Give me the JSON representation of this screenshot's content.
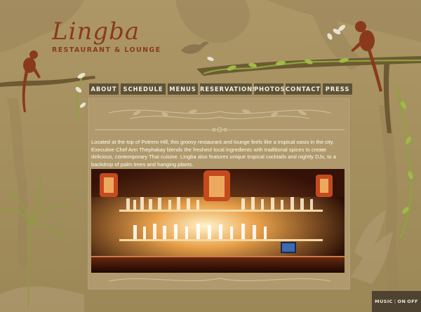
{
  "brand": {
    "name": "Lingba",
    "tagline": "RESTAURANT & LOUNGE"
  },
  "nav": {
    "items": [
      {
        "label": "ABOUT"
      },
      {
        "label": "SCHEDULE"
      },
      {
        "label": "MENUS"
      },
      {
        "label": "RESERVATIONS"
      },
      {
        "label": "PHOTOS"
      },
      {
        "label": "CONTACT"
      },
      {
        "label": "PRESS"
      }
    ]
  },
  "about": {
    "text": "Located at the top of Potrero Hill, this groovy restaurant and lounge feels like a tropical oasis in the city. Executive Chef Ann Thephakay blends the freshest local ingredients with traditional spices to create delicious, contemporary Thai cuisine. Lingba also features unique tropical cocktails and nightly DJs, to a backdrop of palm trees and hanging plants."
  },
  "music": {
    "label": "MUSIC",
    "separator": "|",
    "on": "ON",
    "off": "OFF"
  },
  "colors": {
    "background": "#a48e5f",
    "brand": "#8a3a1c",
    "nav_bg": "#5e5239",
    "nav_text": "#f4eedc"
  },
  "icons": {
    "monkey_left": "monkey-icon",
    "monkey_right": "monkey-icon",
    "vine": "vine-decoration",
    "palm": "palm-tree-icon"
  }
}
